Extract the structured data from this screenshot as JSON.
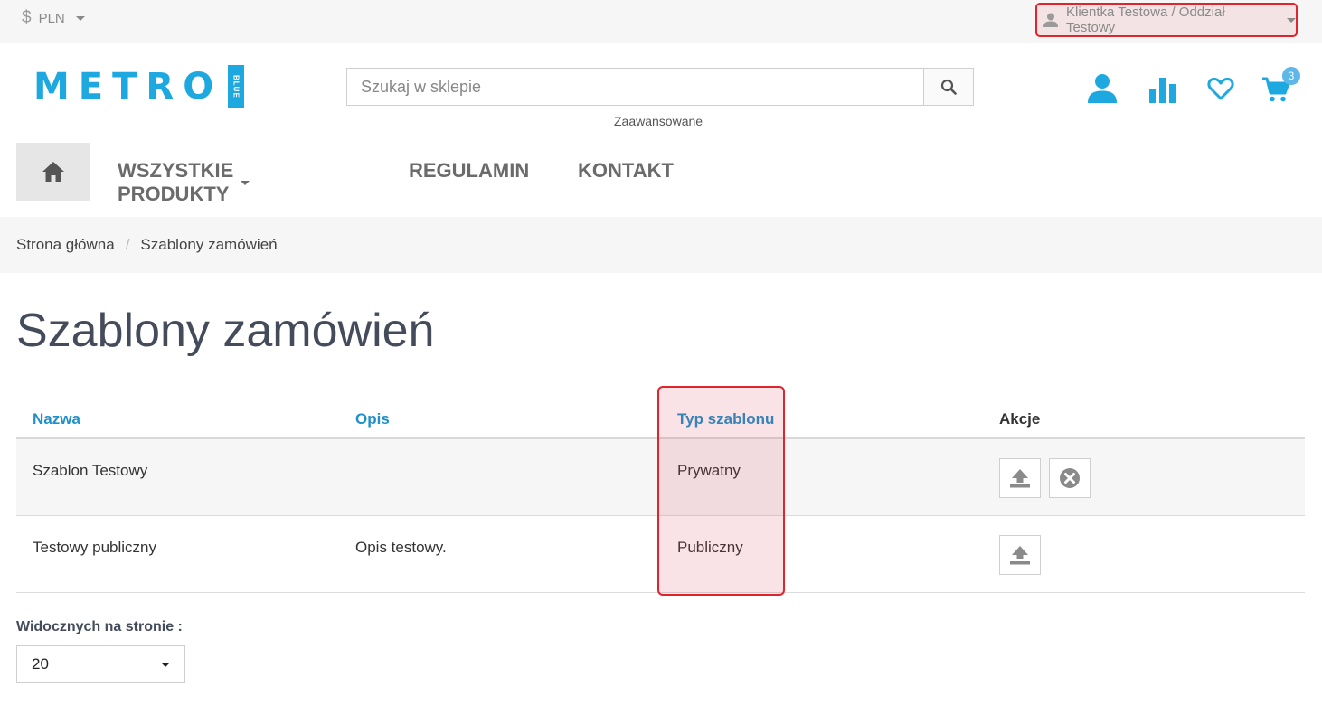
{
  "topbar": {
    "currency": "PLN",
    "account": "Klientka Testowa / Oddział Testowy"
  },
  "header": {
    "logo_text": "METRO",
    "logo_tag": "BLUE",
    "search_placeholder": "Szukaj w sklepie",
    "advanced_link": "Zaawansowane",
    "cart_count": "3",
    "icons": [
      "user-icon",
      "stats-icon",
      "heart-icon",
      "cart-icon",
      "search-icon"
    ],
    "accent_color": "#1ea8e0"
  },
  "nav": {
    "items": [
      {
        "label": "WSZYSTKIE PRODUKTY",
        "has_dropdown": true
      },
      {
        "label": "REGULAMIN"
      },
      {
        "label": "KONTAKT"
      }
    ]
  },
  "breadcrumb": {
    "items": [
      "Strona główna",
      "Szablony zamówień"
    ],
    "separator": "/"
  },
  "page": {
    "title": "Szablony zamówień"
  },
  "table": {
    "columns": [
      "Nazwa",
      "Opis",
      "Typ szablonu",
      "Akcje"
    ],
    "rows": [
      {
        "name": "Szablon Testowy",
        "description": "",
        "type": "Prywatny",
        "actions": [
          "upload",
          "delete"
        ]
      },
      {
        "name": "Testowy publiczny",
        "description": "Opis testowy.",
        "type": "Publiczny",
        "actions": [
          "upload"
        ]
      }
    ]
  },
  "pagination": {
    "per_page_label": "Widocznych na stronie :",
    "per_page_value": "20"
  },
  "highlight_color": "#e0242c"
}
